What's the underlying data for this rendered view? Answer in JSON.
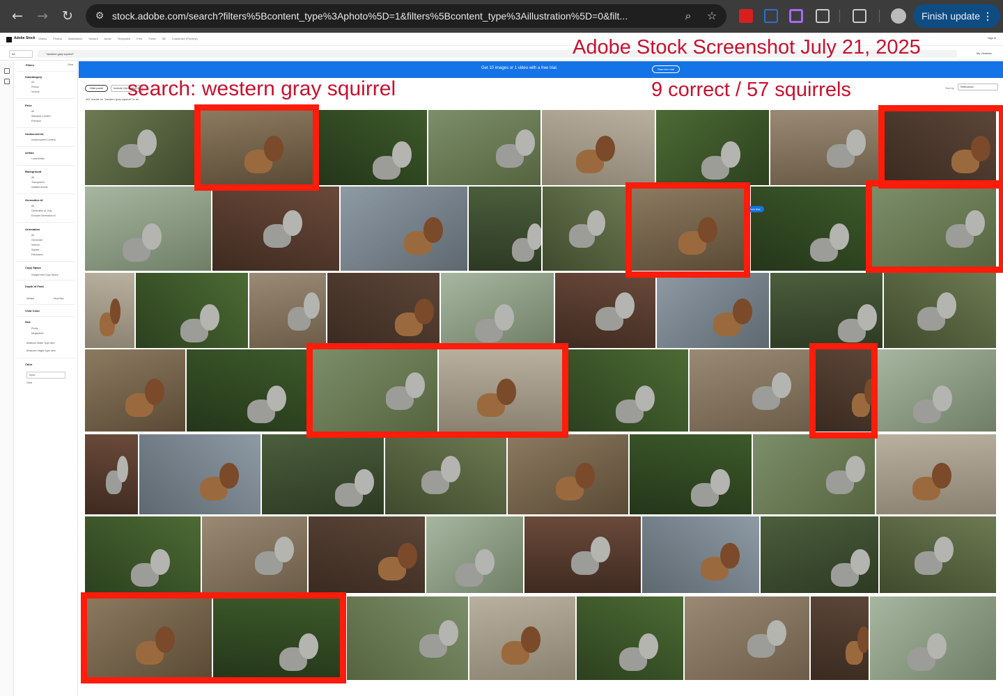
{
  "browser": {
    "url": "stock.adobe.com/search?filters%5Bcontent_type%3Aphoto%5D=1&filters%5Bcontent_type%3Aillustration%5D=0&filt...",
    "update_button": "Finish update"
  },
  "adobe": {
    "brand": "Adobe Stock",
    "nav_links": [
      "Videos",
      "Photos",
      "Illustrations",
      "Vectors",
      "Audio",
      "Templates",
      "Free",
      "Fonts",
      "3D",
      "Customize (Preview)"
    ],
    "sign_in": "Sign in",
    "search": {
      "scope": "All",
      "query": "\"western gray squirrel\""
    },
    "my_libraries": "My Libraries",
    "banner": {
      "text": "Get 10 images or 1 video with a free trial.",
      "button": "Start free trial"
    },
    "toolbar": {
      "hide_panel": "Hide panel",
      "filter_pill": "Include Generative AI",
      "results_text": "441 results for \"western gray squirrel\" in all",
      "sort_label": "Sort by",
      "sort_value": "Relevance"
    },
    "free_trial_badge": "Free trial",
    "filters": {
      "title": "Filters",
      "clear": "Clear",
      "sections": [
        {
          "heading": "Subcategory",
          "items": [
            "All",
            "Photos",
            "Vectors"
          ]
        },
        {
          "heading": "Price",
          "items": [
            "All",
            "Standard Content",
            "Premium"
          ]
        },
        {
          "heading": "Undiscovered",
          "items": [
            "Undiscovered Content"
          ]
        },
        {
          "heading": "Artists",
          "items": [
            "Local Artists"
          ]
        },
        {
          "heading": "Background",
          "items": [
            "All",
            "Transparent",
            "Isolated Assets"
          ]
        },
        {
          "heading": "Generative AI",
          "items": [
            "All",
            "Generative AI Only",
            "Exclude Generative AI"
          ]
        },
        {
          "heading": "Orientation",
          "items": [
            "All",
            "Horizontal",
            "Vertical",
            "Square",
            "Panoramic"
          ]
        },
        {
          "heading": "Copy Space",
          "items": [
            "Images with Copy Space"
          ]
        },
        {
          "heading": "Depth of Field",
          "items": [
            "Default",
            "Most Blur"
          ]
        },
        {
          "heading": "Vivid Color",
          "items": []
        },
        {
          "heading": "Size",
          "items": [
            "Pixels",
            "Megapixels",
            "Minimum Width  Type here",
            "Minimum Height  Type here"
          ]
        },
        {
          "heading": "Color",
          "items": [
            "None",
            "Clear"
          ]
        }
      ]
    }
  },
  "annotations": {
    "title": "Adobe Stock Screenshot July 21, 2025",
    "search": "search: western gray squirrel",
    "count": "9 correct / 57 squirrels"
  },
  "colors": {
    "annotation_red": "#c8102e",
    "highlight_red": "#ff1c0a",
    "banner_blue": "#1473e6",
    "update_button": "#0f4c81"
  }
}
